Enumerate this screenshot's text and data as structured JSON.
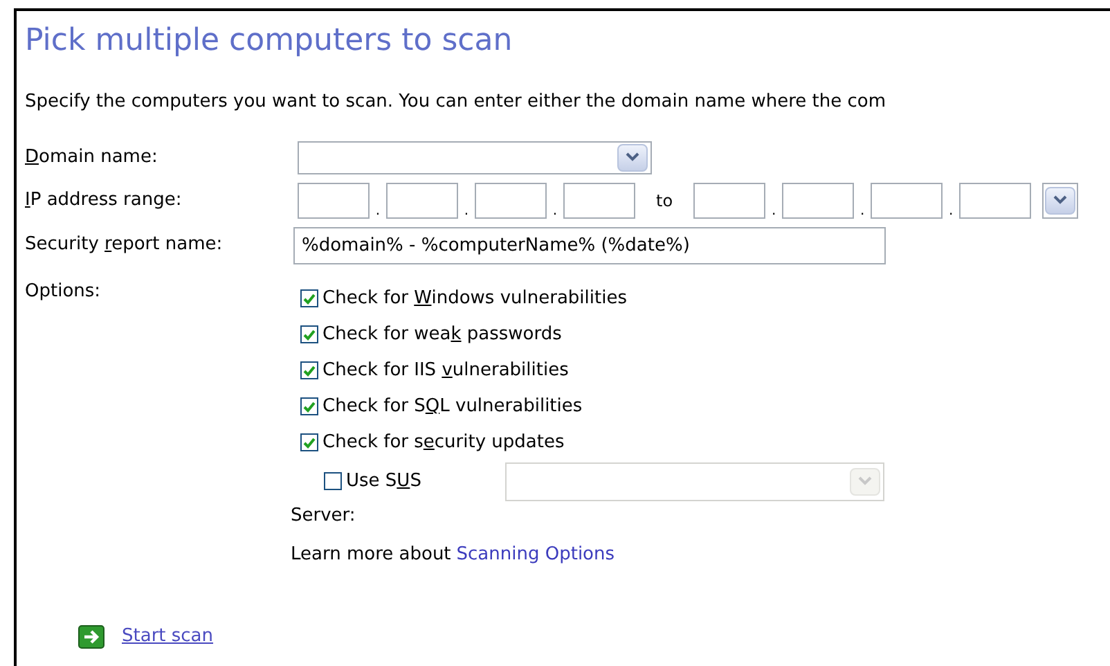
{
  "title": "Pick multiple computers to scan",
  "description": "Specify the computers you want to scan. You can enter either the domain name where the com",
  "domain": {
    "label": {
      "key": "D",
      "after": "omain name:"
    }
  },
  "ip_range": {
    "label": {
      "key": "I",
      "after": "P address range:"
    },
    "separator": ".",
    "to": "to"
  },
  "report_name": {
    "label": {
      "before": "Security ",
      "key": "r",
      "after": "eport name:"
    },
    "value": "%domain% - %computerName% (%date%)"
  },
  "options": {
    "label": "Options:",
    "items": [
      {
        "label": {
          "before": "Check for ",
          "key": "W",
          "after": "indows vulnerabilities"
        },
        "checked": true
      },
      {
        "label": {
          "before": "Check for wea",
          "key": "k",
          "after": " passwords"
        },
        "checked": true
      },
      {
        "label": {
          "before": "Check for IIS ",
          "key": "v",
          "after": "ulnerabilities"
        },
        "checked": true
      },
      {
        "label": {
          "before": "Check for S",
          "key": "Q",
          "after": "L vulnerabilities"
        },
        "checked": true
      },
      {
        "label": {
          "before": "Check for s",
          "key": "e",
          "after": "curity updates"
        },
        "checked": true
      }
    ],
    "sus": {
      "label": {
        "before": "Use S",
        "key": "U",
        "after": "S"
      },
      "checked": false,
      "server_label": "Server:"
    }
  },
  "learn_more": {
    "text": "Learn more about",
    "link": "Scanning Options"
  },
  "start_scan": "Start scan"
}
